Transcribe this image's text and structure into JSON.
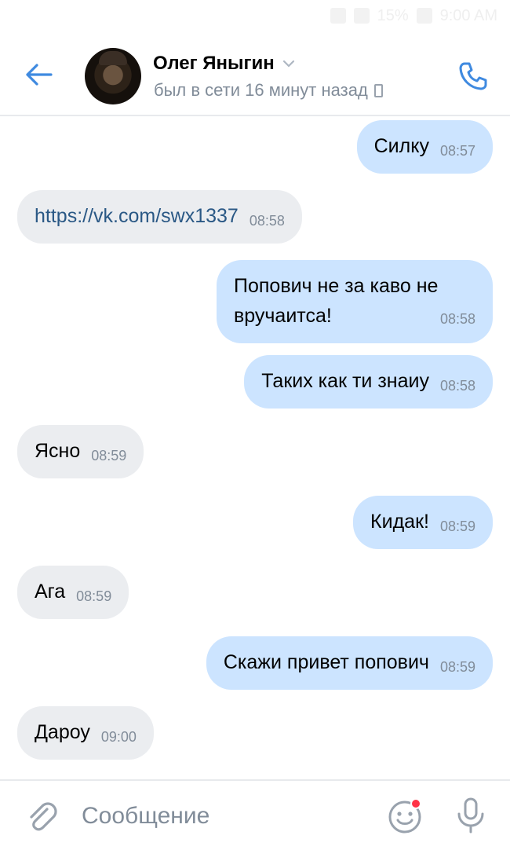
{
  "statusbar": {
    "battery": "15%",
    "time": "9:00 AM"
  },
  "header": {
    "contact_name": "Олег Яныгин",
    "status": "был в сети 16 минут назад"
  },
  "messages": [
    {
      "direction": "out",
      "text": "Силку",
      "time": "08:57"
    },
    {
      "direction": "in",
      "text": "https://vk.com/swx1337",
      "time": "08:58"
    },
    {
      "direction": "out",
      "text": "Попович не за каво не вручаитса!",
      "time": "08:58"
    },
    {
      "direction": "out",
      "text": "Таких как ти знаиу",
      "time": "08:58"
    },
    {
      "direction": "in",
      "text": "Ясно",
      "time": "08:59"
    },
    {
      "direction": "out",
      "text": "Кидак!",
      "time": "08:59"
    },
    {
      "direction": "in",
      "text": "Ага",
      "time": "08:59"
    },
    {
      "direction": "out",
      "text": "Скажи привет попович",
      "time": "08:59"
    },
    {
      "direction": "in",
      "text": "Дароу",
      "time": "09:00"
    }
  ],
  "composer": {
    "placeholder": "Сообщение"
  },
  "colors": {
    "accent": "#3f8ae0",
    "outgoing_bubble": "#cce4ff",
    "incoming_bubble": "#ebedf0",
    "secondary_text": "#818c99"
  },
  "icons": {
    "back": "arrow-left-icon",
    "call": "phone-icon",
    "attach": "paperclip-icon",
    "sticker": "smile-icon",
    "voice": "microphone-icon"
  }
}
